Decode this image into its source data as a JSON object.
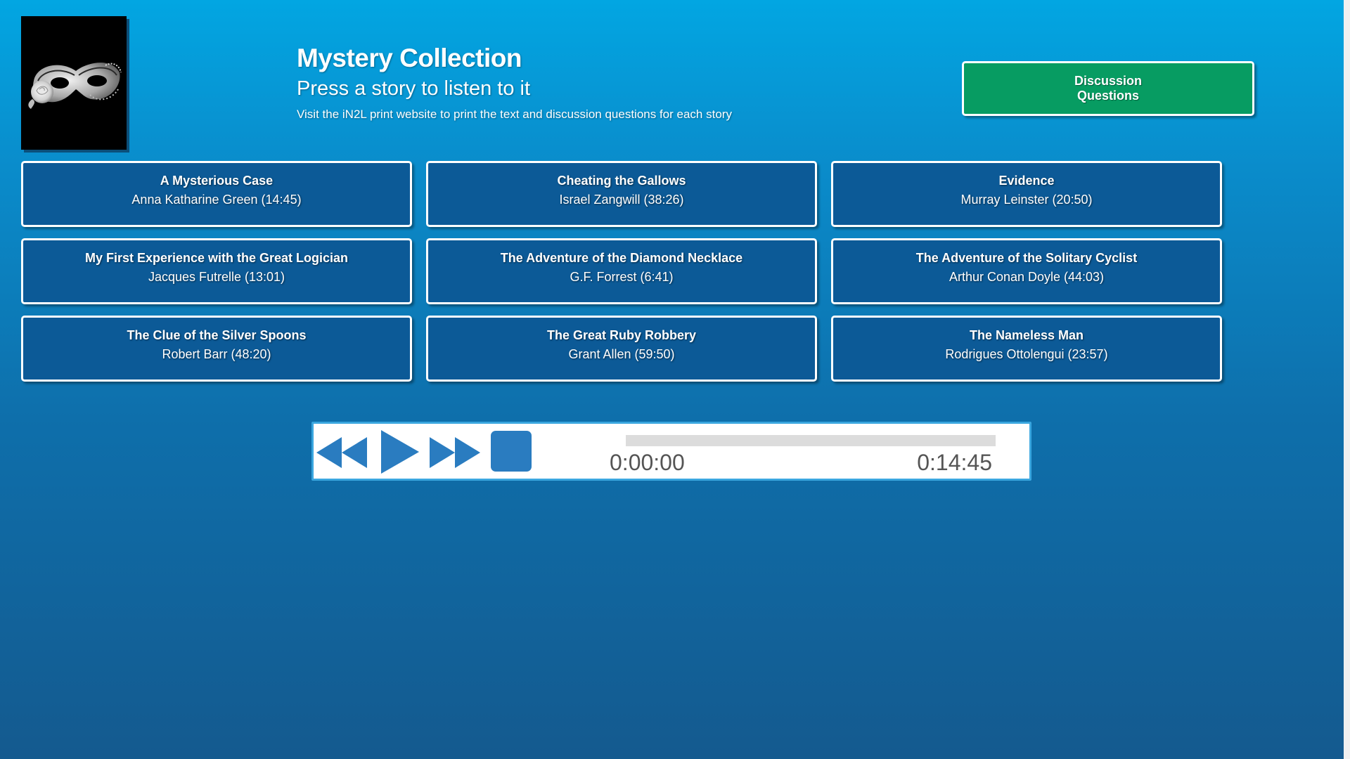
{
  "header": {
    "title": "Mystery Collection",
    "subtitle": "Press a story to listen to it",
    "note": "Visit the iN2L print website to print the text and discussion questions for each story"
  },
  "logo": {
    "icon": "masquerade-mask-icon"
  },
  "discussion_button": {
    "label": "Discussion Questions",
    "color": "#079c62"
  },
  "stories": [
    {
      "title": "A Mysterious Case",
      "author": "Anna Katharine Green (14:45)"
    },
    {
      "title": "Cheating the Gallows",
      "author": "Israel Zangwill (38:26)"
    },
    {
      "title": "Evidence",
      "author": "Murray Leinster (20:50)"
    },
    {
      "title": "My First Experience with the Great Logician",
      "author": "Jacques Futrelle (13:01)"
    },
    {
      "title": "The Adventure of the Diamond Necklace",
      "author": "G.F. Forrest (6:41)"
    },
    {
      "title": "The Adventure of the Solitary Cyclist",
      "author": "Arthur Conan Doyle (44:03)"
    },
    {
      "title": "The Clue of the Silver Spoons",
      "author": "Robert Barr (48:20)"
    },
    {
      "title": "The Great Ruby Robbery",
      "author": "Grant Allen (59:50)"
    },
    {
      "title": "The Nameless Man",
      "author": "Rodrigues Ottolengui (23:57)"
    }
  ],
  "player": {
    "controls": [
      "rewind-icon",
      "play-icon",
      "fast-forward-icon",
      "stop-icon"
    ],
    "current_time": "0:00:00",
    "total_time": "0:14:45",
    "progress": 0,
    "accent_color": "#2a7cc0"
  },
  "colors": {
    "story_button": "#0c5a97",
    "background_top": "#02a6e2",
    "background_bottom": "#145a8f"
  }
}
